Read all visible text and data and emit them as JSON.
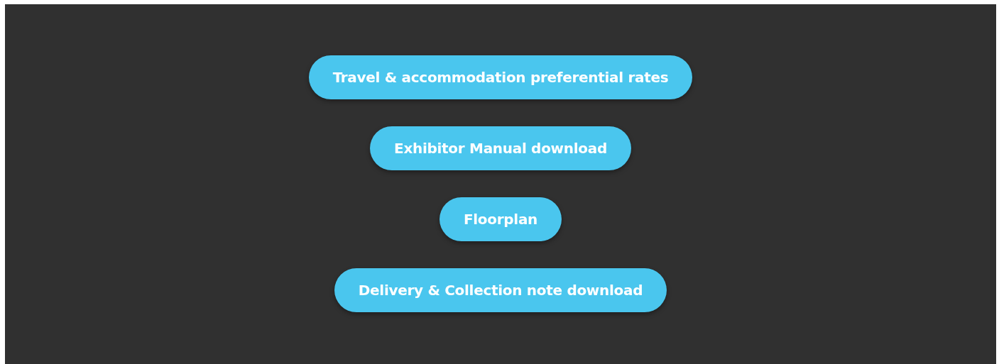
{
  "buttons": [
    {
      "label": "Travel & accommodation preferential rates"
    },
    {
      "label": "Exhibitor Manual download"
    },
    {
      "label": "Floorplan"
    },
    {
      "label": "Delivery & Collection note download"
    }
  ]
}
